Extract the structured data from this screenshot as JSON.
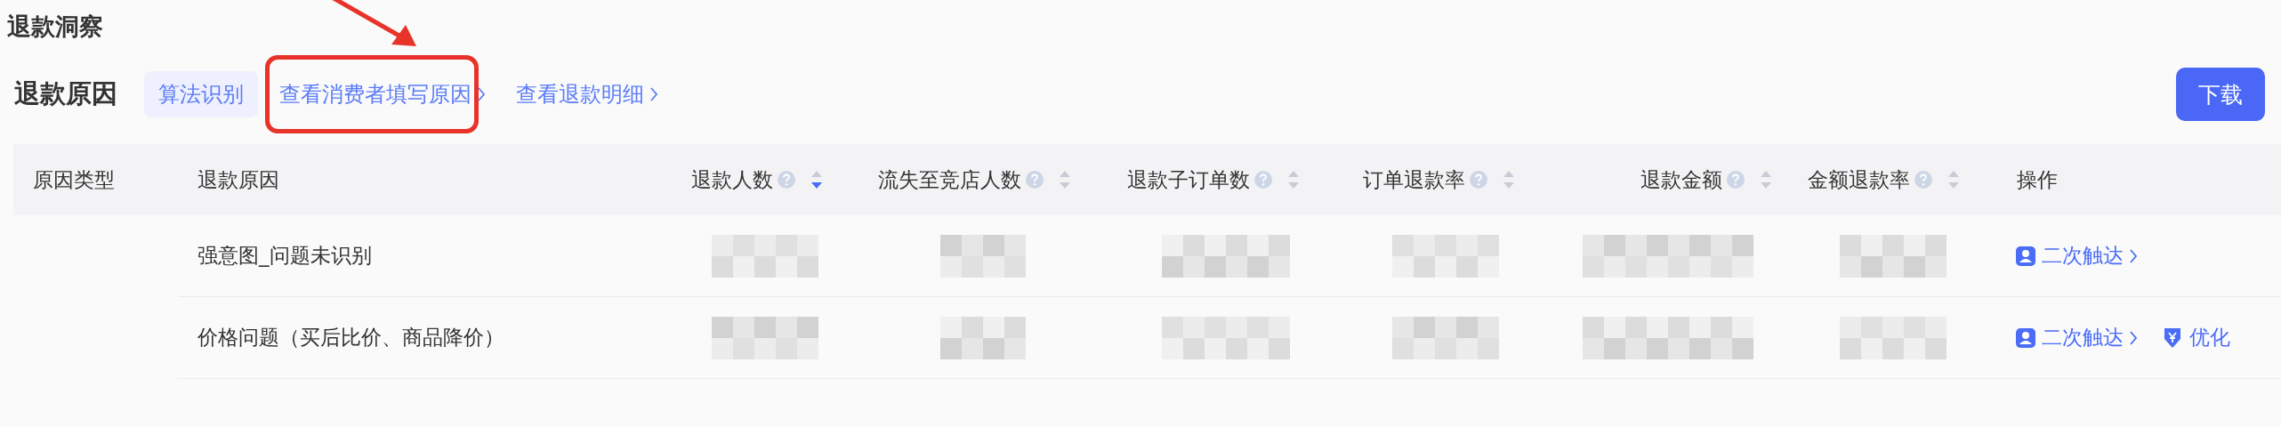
{
  "page_title": "退款洞察",
  "section": {
    "title": "退款原因",
    "tabs": [
      {
        "label": "算法识别",
        "selected": true,
        "highlighted": false,
        "chevron": false
      },
      {
        "label": "查看消费者填写原因",
        "selected": false,
        "highlighted": true,
        "chevron": true
      },
      {
        "label": "查看退款明细",
        "selected": false,
        "highlighted": false,
        "chevron": true
      }
    ],
    "download_button": "下载"
  },
  "table": {
    "columns": [
      {
        "label": "原因类型"
      },
      {
        "label": "退款原因"
      },
      {
        "label": "退款人数",
        "help": true,
        "sort_descending": true
      },
      {
        "label": "流失至竞店人数",
        "help": true,
        "sort_descending": false
      },
      {
        "label": "退款子订单数",
        "help": true,
        "sort_descending": false
      },
      {
        "label": "订单退款率",
        "help": true,
        "sort_descending": false
      },
      {
        "label": "退款金额",
        "help": true,
        "sort_descending": false
      },
      {
        "label": "金额退款率",
        "help": true,
        "sort_descending": false
      },
      {
        "label": "操作"
      }
    ],
    "rows": [
      {
        "reason": "强意图_问题未识别",
        "actions": [
          {
            "label": "二次触达",
            "kind": "contact"
          }
        ]
      },
      {
        "reason": "价格问题（买后比价、商品降价）",
        "actions": [
          {
            "label": "二次触达",
            "kind": "contact"
          },
          {
            "label": "优化",
            "kind": "optimize"
          }
        ]
      }
    ]
  }
}
